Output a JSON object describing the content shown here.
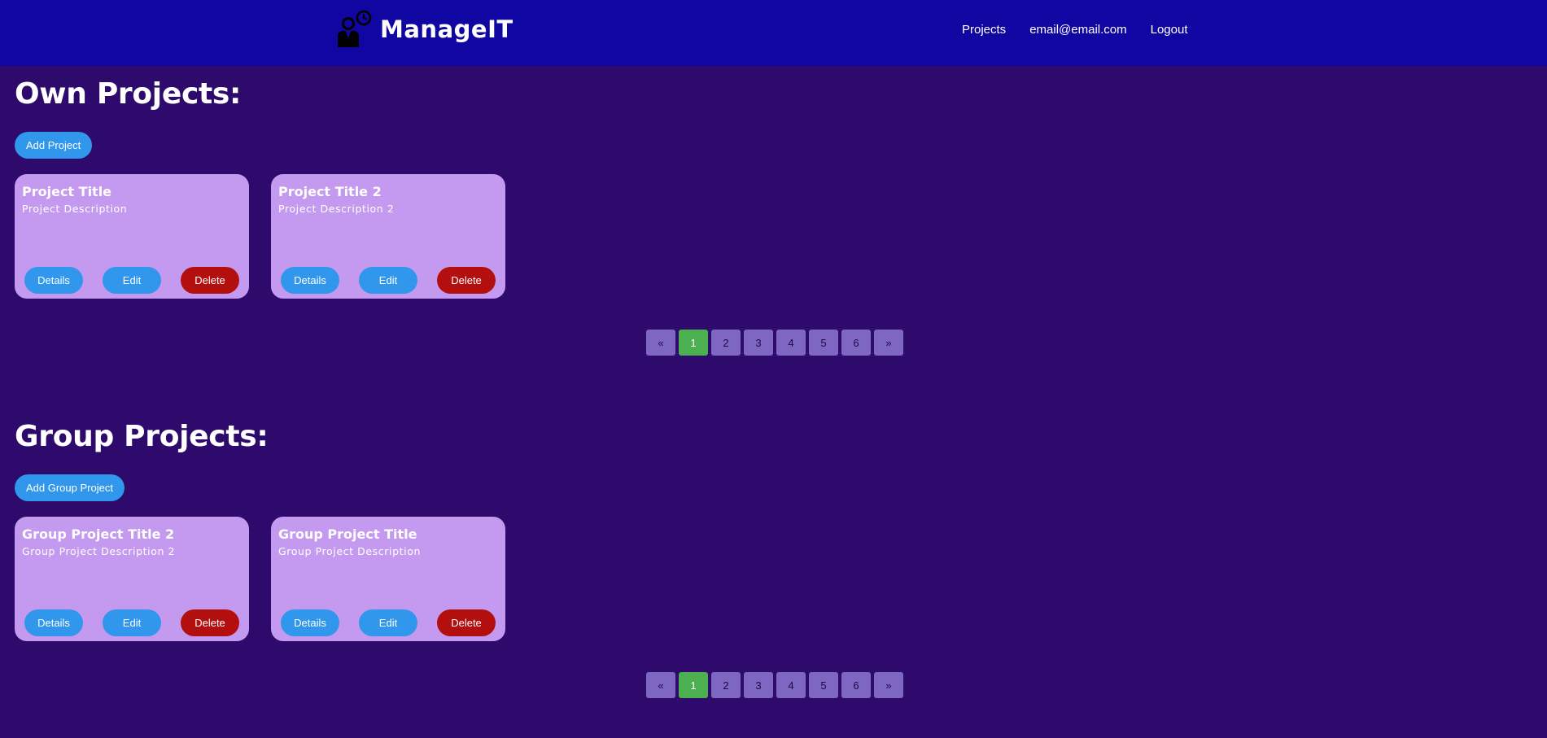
{
  "brand": {
    "name": "ManageIT",
    "logo_icon": "manager-clock-icon"
  },
  "nav": {
    "links": [
      "Projects",
      "email@email.com",
      "Logout"
    ]
  },
  "colors": {
    "navbar": "#1006a2",
    "background": "#2d0a6b",
    "card": "#c49af0",
    "primary_button": "#3197ec",
    "danger_button": "#b30f0f",
    "page_button": "#7d67c2",
    "active_page": "#4caf50"
  },
  "own_projects": {
    "title": "Own Projects:",
    "add_label": "Add Project",
    "cards": [
      {
        "title": "Project Title",
        "description": "Project Description",
        "details_label": "Details",
        "edit_label": "Edit",
        "delete_label": "Delete"
      },
      {
        "title": "Project Title 2",
        "description": "Project Description 2",
        "details_label": "Details",
        "edit_label": "Edit",
        "delete_label": "Delete"
      }
    ],
    "pagination": {
      "prev": "«",
      "pages": [
        "1",
        "2",
        "3",
        "4",
        "5",
        "6"
      ],
      "next": "»",
      "current": "1"
    }
  },
  "group_projects": {
    "title": "Group Projects:",
    "add_label": "Add Group Project",
    "cards": [
      {
        "title": "Group Project Title 2",
        "description": "Group Project Description 2",
        "details_label": "Details",
        "edit_label": "Edit",
        "delete_label": "Delete"
      },
      {
        "title": "Group Project Title",
        "description": "Group Project Description",
        "details_label": "Details",
        "edit_label": "Edit",
        "delete_label": "Delete"
      }
    ],
    "pagination": {
      "prev": "«",
      "pages": [
        "1",
        "2",
        "3",
        "4",
        "5",
        "6"
      ],
      "next": "»",
      "current": "1"
    }
  }
}
